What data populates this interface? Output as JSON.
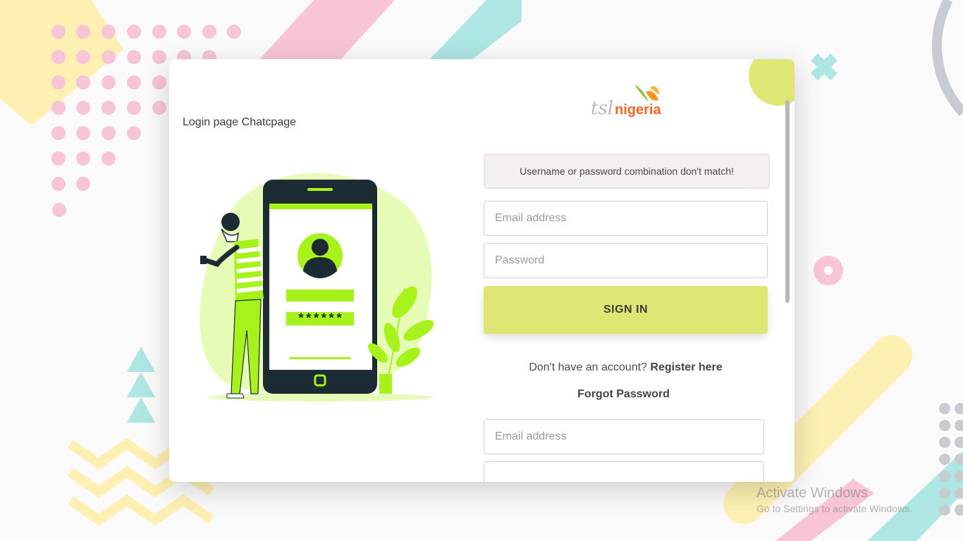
{
  "page": {
    "caption": "Login page Chatcpage"
  },
  "logo": {
    "prefix": "tsl",
    "name": "nigeria"
  },
  "alert": {
    "message": "Username or password combination don't match!"
  },
  "login_form": {
    "email_placeholder": "Email address",
    "password_placeholder": "Password",
    "submit_label": "SIGN IN"
  },
  "links": {
    "register_prompt": "Don't have an account?",
    "register_label": "Register here",
    "forgot_label": "Forgot Password"
  },
  "forgot_form": {
    "email_placeholder": "Email address"
  },
  "illustration": {
    "password_mask": "******"
  },
  "watermark": {
    "title": "Activate Windows",
    "subtitle": "Go to Settings to activate Windows."
  },
  "colors": {
    "accent": "#dfe774",
    "lime": "#a6f21a",
    "pink": "#f7c5d6",
    "teal": "#aee6e3",
    "yellow": "#fdf0b2"
  }
}
